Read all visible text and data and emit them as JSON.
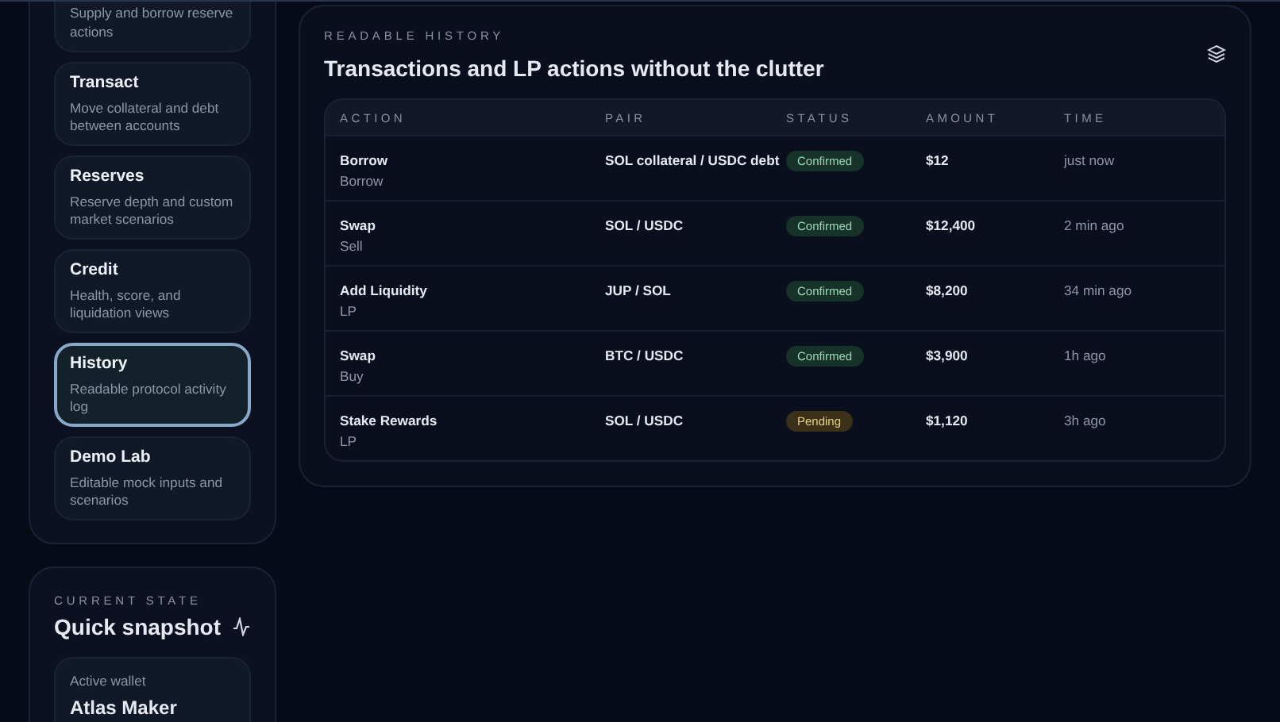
{
  "sidebar": {
    "items": [
      {
        "description": "Supply and borrow reserve actions",
        "selected": false
      },
      {
        "title": "Transact",
        "description": "Move collateral and debt between accounts",
        "selected": false
      },
      {
        "title": "Reserves",
        "description": "Reserve depth and custom market scenarios",
        "selected": false
      },
      {
        "title": "Credit",
        "description": "Health, score, and liquidation views",
        "selected": false
      },
      {
        "title": "History",
        "description": "Readable protocol activity log",
        "selected": true
      },
      {
        "title": "Demo Lab",
        "description": "Editable mock inputs and scenarios",
        "selected": false
      }
    ]
  },
  "snapshot": {
    "eyebrow": "CURRENT STATE",
    "title": "Quick snapshot",
    "wallet_label": "Active wallet",
    "wallet_name": "Atlas Maker"
  },
  "history": {
    "eyebrow": "READABLE HISTORY",
    "title": "Transactions and LP actions without the clutter",
    "columns": [
      "ACTION",
      "PAIR",
      "STATUS",
      "AMOUNT",
      "TIME"
    ],
    "rows": [
      {
        "action": "Borrow",
        "subtype": "Borrow",
        "pair": "SOL collateral / USDC debt",
        "status": "Confirmed",
        "kind": "confirmed",
        "amount": "$12",
        "time": "just now"
      },
      {
        "action": "Swap",
        "subtype": "Sell",
        "pair": "SOL / USDC",
        "status": "Confirmed",
        "kind": "confirmed",
        "amount": "$12,400",
        "time": "2 min ago"
      },
      {
        "action": "Add Liquidity",
        "subtype": "LP",
        "pair": "JUP / SOL",
        "status": "Confirmed",
        "kind": "confirmed",
        "amount": "$8,200",
        "time": "34 min ago"
      },
      {
        "action": "Swap",
        "subtype": "Buy",
        "pair": "BTC / USDC",
        "status": "Confirmed",
        "kind": "confirmed",
        "amount": "$3,900",
        "time": "1h ago"
      },
      {
        "action": "Stake Rewards",
        "subtype": "LP",
        "pair": "SOL / USDC",
        "status": "Pending",
        "kind": "pending",
        "amount": "$1,120",
        "time": "3h ago"
      }
    ]
  }
}
